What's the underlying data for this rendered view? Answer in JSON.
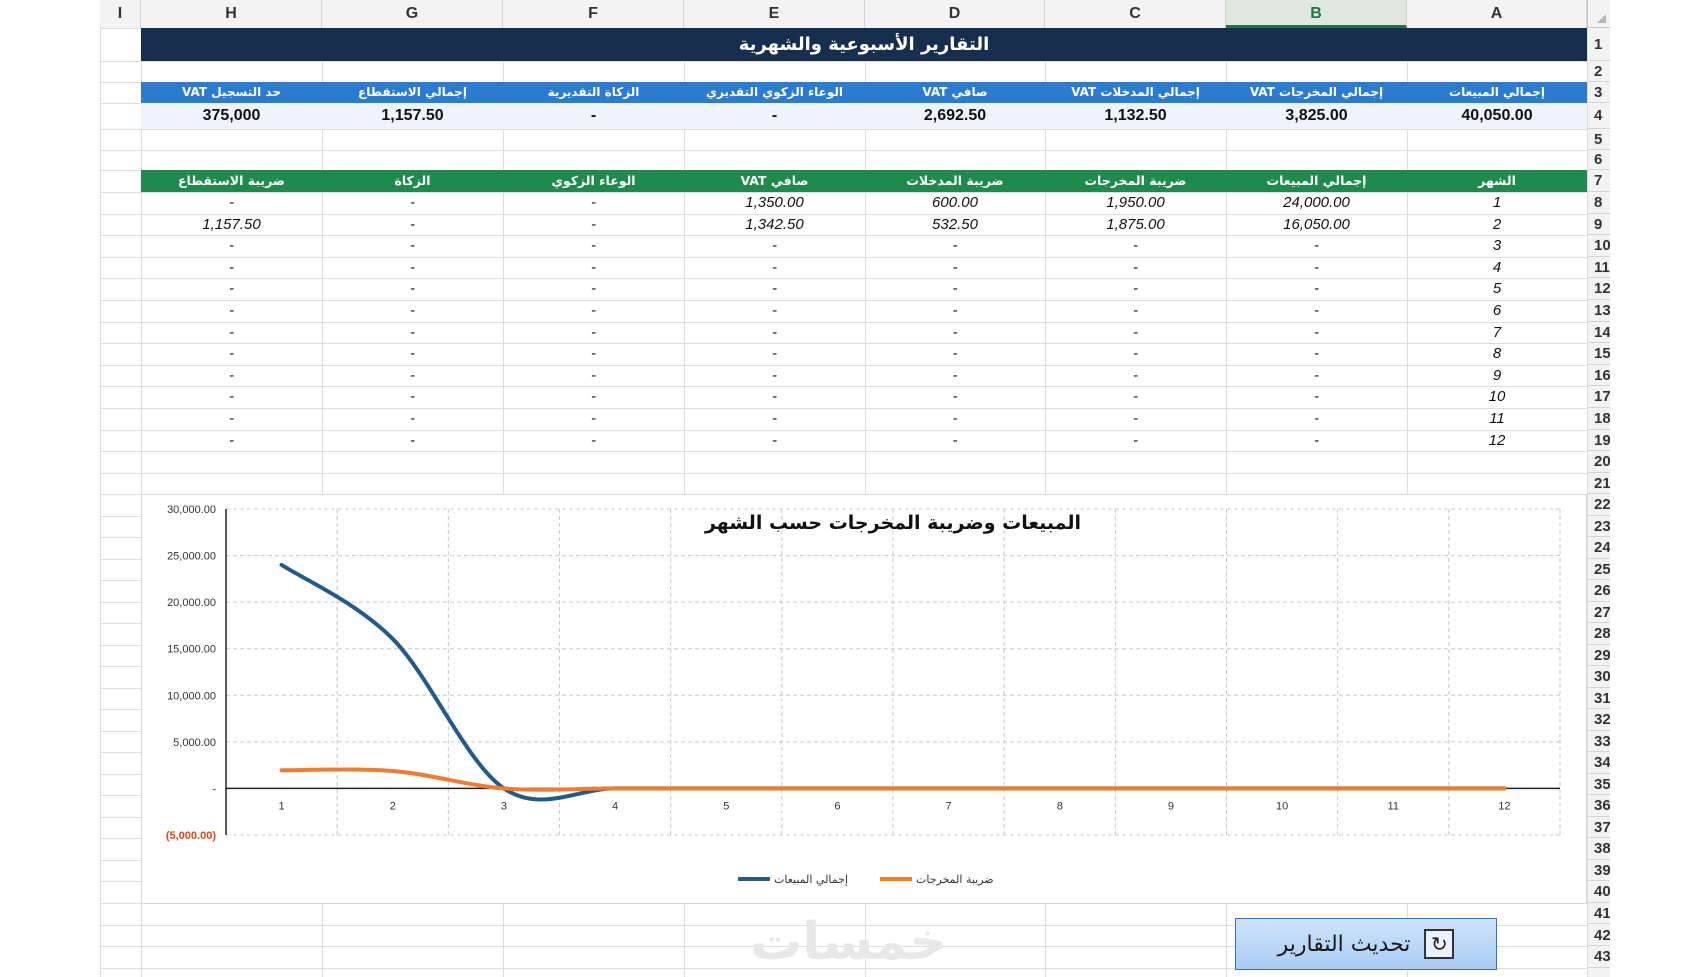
{
  "columns": [
    "I",
    "H",
    "G",
    "F",
    "E",
    "D",
    "C",
    "B",
    "A"
  ],
  "rows": [
    "1",
    "2",
    "3",
    "4",
    "5",
    "6",
    "7",
    "8",
    "9",
    "10",
    "11",
    "12",
    "13",
    "14",
    "15",
    "16",
    "17",
    "18",
    "19",
    "20",
    "21",
    "22",
    "23",
    "24",
    "25",
    "26",
    "27",
    "28",
    "29",
    "30",
    "31",
    "32",
    "33",
    "34",
    "35",
    "36",
    "37",
    "38",
    "39",
    "40",
    "41",
    "42",
    "43"
  ],
  "title": "التقارير الأسبوعية والشهرية",
  "summary": {
    "headers": [
      "حد التسجيل VAT",
      "إجمالي الاستقطاع",
      "الزكاة التقديرية",
      "الوعاء الزكوي التقديري",
      "صافي VAT",
      "إجمالي المدخلات VAT",
      "إجمالي المخرجات VAT",
      "إجمالي المبيعات"
    ],
    "values": [
      "375,000",
      "1,157.50",
      "-",
      "-",
      "2,692.50",
      "1,132.50",
      "3,825.00",
      "40,050.00"
    ]
  },
  "monthly": {
    "headers": [
      "ضريبة الاستقطاع",
      "الزكاة",
      "الوعاء الزكوي",
      "صافي VAT",
      "ضريبة المدخلات",
      "ضريبة المخرجات",
      "إجمالي المبيعات",
      "الشهر"
    ],
    "rows": [
      [
        "-",
        "-",
        "-",
        "1,350.00",
        "600.00",
        "1,950.00",
        "24,000.00",
        "1"
      ],
      [
        "1,157.50",
        "-",
        "-",
        "1,342.50",
        "532.50",
        "1,875.00",
        "16,050.00",
        "2"
      ],
      [
        "-",
        "-",
        "-",
        "-",
        "-",
        "-",
        "-",
        "3"
      ],
      [
        "-",
        "-",
        "-",
        "-",
        "-",
        "-",
        "-",
        "4"
      ],
      [
        "-",
        "-",
        "-",
        "-",
        "-",
        "-",
        "-",
        "5"
      ],
      [
        "-",
        "-",
        "-",
        "-",
        "-",
        "-",
        "-",
        "6"
      ],
      [
        "-",
        "-",
        "-",
        "-",
        "-",
        "-",
        "-",
        "7"
      ],
      [
        "-",
        "-",
        "-",
        "-",
        "-",
        "-",
        "-",
        "8"
      ],
      [
        "-",
        "-",
        "-",
        "-",
        "-",
        "-",
        "-",
        "9"
      ],
      [
        "-",
        "-",
        "-",
        "-",
        "-",
        "-",
        "-",
        "10"
      ],
      [
        "-",
        "-",
        "-",
        "-",
        "-",
        "-",
        "-",
        "11"
      ],
      [
        "-",
        "-",
        "-",
        "-",
        "-",
        "-",
        "-",
        "12"
      ]
    ]
  },
  "chart_data": {
    "type": "line",
    "title": "المبيعات وضريبة المخرجات حسب الشهر",
    "x": [
      1,
      2,
      3,
      4,
      5,
      6,
      7,
      8,
      9,
      10,
      11,
      12
    ],
    "ylim": [
      -5000,
      30000
    ],
    "yticks": [
      30000,
      25000,
      20000,
      15000,
      10000,
      5000,
      0,
      -5000
    ],
    "ytick_labels": [
      "30,000.00",
      "25,000.00",
      "20,000.00",
      "15,000.00",
      "10,000.00",
      "5,000.00",
      "-",
      "(5,000.00)"
    ],
    "grid": true,
    "legend": "bottom",
    "series": [
      {
        "name": "إجمالي المبيعات",
        "color": "#1f5c8b",
        "values": [
          24000,
          16050,
          0,
          0,
          0,
          0,
          0,
          0,
          0,
          0,
          0,
          0
        ]
      },
      {
        "name": "ضريبة المخرجات",
        "color": "#ed7d31",
        "values": [
          1950,
          1875,
          0,
          0,
          0,
          0,
          0,
          0,
          0,
          0,
          0,
          0
        ]
      }
    ]
  },
  "button": {
    "label": "تحديث التقارير",
    "icon": "refresh-icon"
  },
  "watermark": "خمسات"
}
